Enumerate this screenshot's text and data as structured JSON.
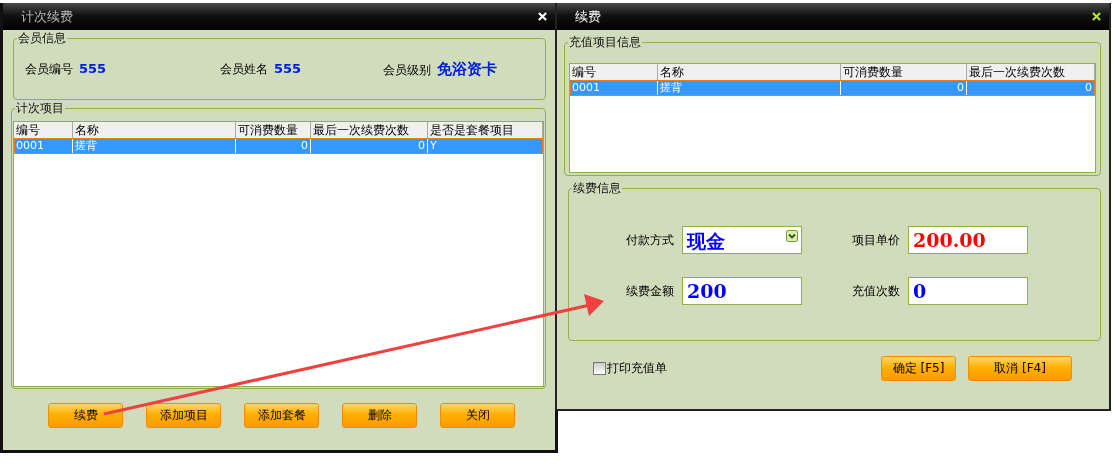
{
  "left_window": {
    "title": "计次续费",
    "member_info": {
      "legend": "会员信息",
      "fields": [
        {
          "label": "会员编号",
          "value": "555"
        },
        {
          "label": "会员姓名",
          "value": "555"
        },
        {
          "label": "会员级别",
          "value": "免浴资卡"
        }
      ]
    },
    "items": {
      "legend": "计次项目",
      "columns": [
        "编号",
        "名称",
        "可消费数量",
        "最后一次续费次数",
        "是否是套餐项目"
      ],
      "rows": [
        {
          "cells": [
            "0001",
            "搓背",
            "0",
            "0",
            "Y"
          ],
          "selected": true
        }
      ]
    },
    "buttons": [
      "续费",
      "添加项目",
      "添加套餐",
      "删除",
      "关闭"
    ]
  },
  "right_window": {
    "title": "续费",
    "recharge_items": {
      "legend": "充值项目信息",
      "columns": [
        "编号",
        "名称",
        "可消费数量",
        "最后一次续费次数"
      ],
      "rows": [
        {
          "cells": [
            "0001",
            "搓背",
            "0",
            "0"
          ],
          "selected": true
        }
      ]
    },
    "renewal_info": {
      "legend": "续费信息",
      "fields": [
        {
          "label": "付款方式",
          "value": "现金",
          "kind": "dropdown",
          "color": "#0000ff"
        },
        {
          "label": "项目单价",
          "value": "200.00",
          "kind": "text",
          "color": "#ff0000"
        },
        {
          "label": "续费金额",
          "value": "200",
          "kind": "text",
          "color": "#0000ff"
        },
        {
          "label": "充值次数",
          "value": "0",
          "kind": "text",
          "color": "#0000ff"
        }
      ]
    },
    "print_receipt": {
      "label": "打印充值单",
      "checked": false
    },
    "buttons": [
      "确定 [F5]",
      "取消 [F4]"
    ]
  }
}
